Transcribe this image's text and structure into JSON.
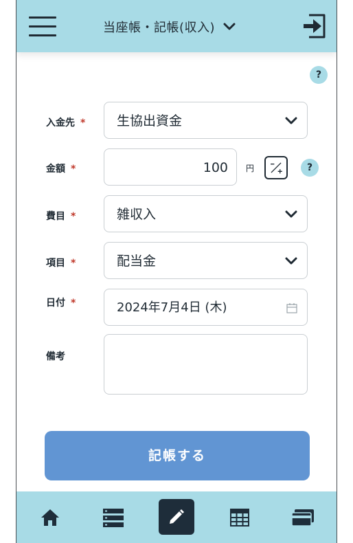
{
  "header": {
    "title": "当座帳・記帳(収入)",
    "menu_icon": "hamburger-menu-icon",
    "title_dropdown_icon": "chevron-down-icon",
    "logout_icon": "logout-icon"
  },
  "help_label": "?",
  "form": {
    "required_mark": "*",
    "payee": {
      "label": "入金先",
      "value": "生協出資金"
    },
    "amount": {
      "label": "金額",
      "value": "100",
      "unit": "円"
    },
    "expense_category": {
      "label": "費目",
      "value": "雑収入"
    },
    "item": {
      "label": "項目",
      "value": "配当金"
    },
    "date": {
      "label": "日付",
      "value": "2024年7月4日 (木)"
    },
    "memo": {
      "label": "備考",
      "value": ""
    }
  },
  "submit_label": "記帳する",
  "bottom_nav": {
    "items": [
      {
        "name": "home",
        "icon": "home-icon"
      },
      {
        "name": "list",
        "icon": "list-icon"
      },
      {
        "name": "entry",
        "icon": "pencil-icon",
        "active": true
      },
      {
        "name": "table",
        "icon": "table-icon"
      },
      {
        "name": "card",
        "icon": "credit-card-icon"
      }
    ]
  },
  "colors": {
    "header_bg": "#a8dbe6",
    "accent_button": "#6195d3",
    "required": "#c0392b",
    "active_nav": "#1e2d3a"
  }
}
